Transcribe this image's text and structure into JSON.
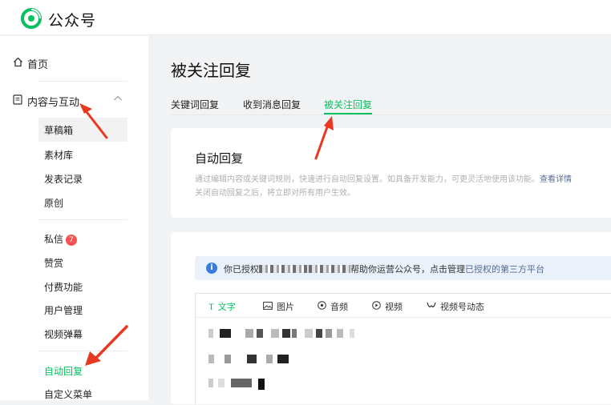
{
  "header": {
    "brand": "公众号",
    "brand_color": "#07c160"
  },
  "sidebar": {
    "home": "首页",
    "content_section": "内容与互动",
    "content_items": [
      "草稿箱",
      "素材库",
      "发表记录",
      "原创"
    ],
    "messages": "私信",
    "messages_badge": "7",
    "interact_items": [
      "赞赏",
      "付费功能",
      "用户管理",
      "视频弹幕"
    ],
    "auto_reply": "自动回复",
    "custom_menu": "自定义菜单"
  },
  "main": {
    "title": "被关注回复",
    "tabs": [
      "关键词回复",
      "收到消息回复",
      "被关注回复"
    ],
    "active_tab_index": 2,
    "card": {
      "heading": "自动回复",
      "desc_line1": "通过编辑内容或关键词规则，快速进行自动回复设置。如具备开发能力，可更灵活地使用该功能。",
      "desc_link": "查看详情",
      "desc_line2": "关闭自动回复之后，将立即对所有用户生效。"
    },
    "banner": {
      "prefix": "你已授权",
      "middle": "帮助你运营公众号，点击管理",
      "link": "已授权的第三方平台"
    },
    "editor_tools": [
      "文字",
      "图片",
      "音频",
      "视频",
      "视频号动态"
    ],
    "editor_tool_icons": [
      "text-icon",
      "image-icon",
      "audio-icon",
      "video-icon",
      "channels-icon"
    ]
  },
  "colors": {
    "accent": "#07c160",
    "link": "#576b95",
    "annotation_arrow": "#e8381f",
    "badge": "#fa5151"
  }
}
